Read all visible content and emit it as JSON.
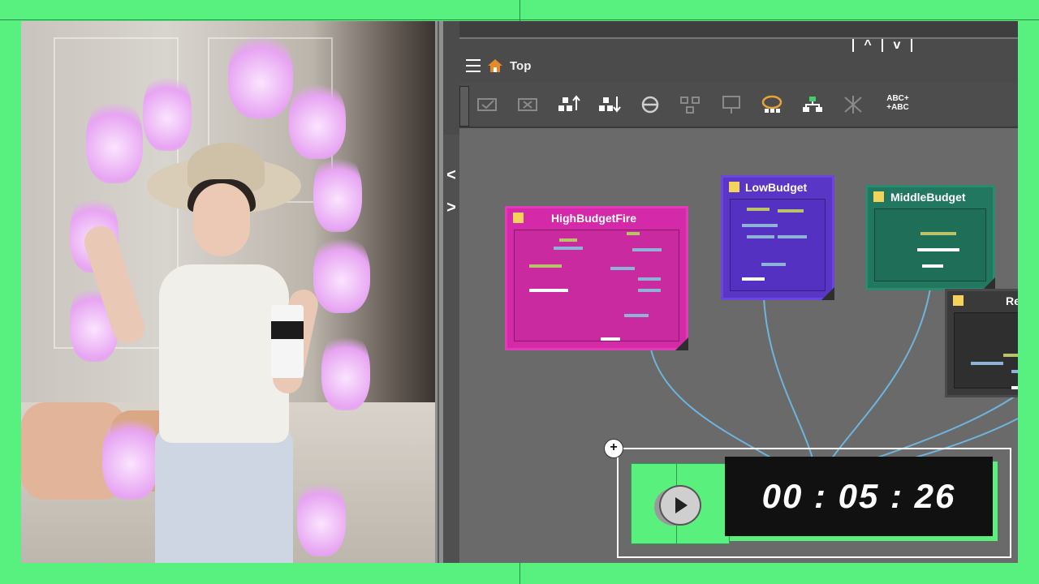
{
  "breadcrumb": {
    "label": "Top",
    "menu_icon": "menu-icon",
    "home_icon": "home-icon"
  },
  "scroll_controls": {
    "up": "^",
    "down": "v"
  },
  "toolbar": {
    "tools": [
      "check-box-icon",
      "cross-box-icon",
      "move-up-icon",
      "move-down-icon",
      "zoom-icon",
      "layout-icon",
      "frame-icon",
      "lasso-icon",
      "tree-icon",
      "fx-icon"
    ],
    "abc_label_1": "ABC+",
    "abc_label_2": "+ABC"
  },
  "side_panel": {
    "collapse": "<",
    "expand": ">"
  },
  "nodes": [
    {
      "title": "HighBudgetFire",
      "color": "#d42aa9"
    },
    {
      "title": "LowBudget",
      "color": "#5a36c7"
    },
    {
      "title": "MiddleBudget",
      "color": "#21775f"
    },
    {
      "title": "Refer",
      "color": "#3a3a3a"
    }
  ],
  "timer": {
    "time": "00 : 05 : 26",
    "plus": "+"
  },
  "colors": {
    "wire": "#6fb4dd",
    "screen_green": "#58f07e",
    "canvas": "#6a6a6a"
  }
}
